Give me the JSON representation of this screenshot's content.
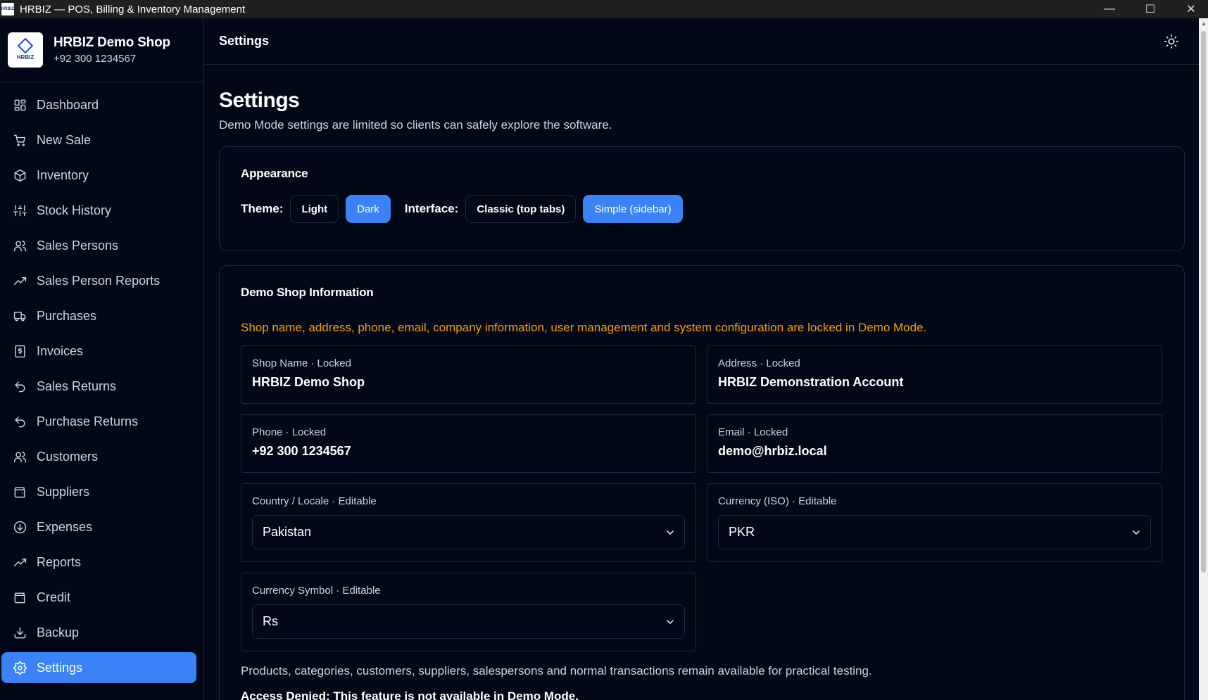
{
  "window": {
    "title": "HRBIZ — POS, Billing & Inventory Management",
    "icon_text": "HRBIZ",
    "minimize": "—",
    "maximize": "☐",
    "close": "✕"
  },
  "brand": {
    "logo_text": "HRBIZ",
    "shop_name": "HRBIZ Demo Shop",
    "phone": "+92 300 1234567"
  },
  "sidebar": {
    "items": [
      {
        "label": "Dashboard",
        "icon": "dashboard-icon"
      },
      {
        "label": "New Sale",
        "icon": "cart-icon"
      },
      {
        "label": "Inventory",
        "icon": "package-icon"
      },
      {
        "label": "Stock History",
        "icon": "sliders-icon"
      },
      {
        "label": "Sales Persons",
        "icon": "users-icon"
      },
      {
        "label": "Sales Person Reports",
        "icon": "trending-up-icon"
      },
      {
        "label": "Purchases",
        "icon": "truck-icon"
      },
      {
        "label": "Invoices",
        "icon": "receipt-icon"
      },
      {
        "label": "Sales Returns",
        "icon": "undo-icon"
      },
      {
        "label": "Purchase Returns",
        "icon": "undo-icon"
      },
      {
        "label": "Customers",
        "icon": "users-icon"
      },
      {
        "label": "Suppliers",
        "icon": "wallet-icon"
      },
      {
        "label": "Expenses",
        "icon": "arrow-down-circle-icon"
      },
      {
        "label": "Reports",
        "icon": "trending-up-icon"
      },
      {
        "label": "Credit",
        "icon": "wallet-icon"
      },
      {
        "label": "Backup",
        "icon": "download-icon"
      },
      {
        "label": "Settings",
        "icon": "gear-icon",
        "active": true
      }
    ]
  },
  "header": {
    "title": "Settings",
    "theme_toggle_icon": "sun-icon"
  },
  "page": {
    "title": "Settings",
    "subtitle": "Demo Mode settings are limited so clients can safely explore the software."
  },
  "appearance": {
    "heading": "Appearance",
    "theme_label": "Theme:",
    "theme_light": "Light",
    "theme_dark": "Dark",
    "theme_selected": "Dark",
    "interface_label": "Interface:",
    "interface_classic": "Classic (top tabs)",
    "interface_simple": "Simple (sidebar)",
    "interface_selected": "Simple (sidebar)"
  },
  "shop_info": {
    "heading": "Demo Shop Information",
    "warning": "Shop name, address, phone, email, company information, user management and system configuration are locked in Demo Mode.",
    "shop_name_label": "Shop Name · Locked",
    "shop_name_value": "HRBIZ Demo Shop",
    "address_label": "Address · Locked",
    "address_value": "HRBIZ Demonstration Account",
    "phone_label": "Phone · Locked",
    "phone_value": "+92 300 1234567",
    "email_label": "Email · Locked",
    "email_value": "demo@hrbiz.local",
    "country_label": "Country / Locale · Editable",
    "country_value": "Pakistan",
    "currency_label": "Currency (ISO) · Editable",
    "currency_value": "PKR",
    "symbol_label": "Currency Symbol · Editable",
    "symbol_value": "Rs",
    "footnote": "Products, categories, customers, suppliers, salespersons and normal transactions remain available for practical testing.",
    "cut_text": "Access Denied: This feature is not available in Demo Mode."
  },
  "colors": {
    "background": "#020817",
    "accent": "#3b82f6",
    "warning": "#f59e0b",
    "border": "#1e293b"
  }
}
